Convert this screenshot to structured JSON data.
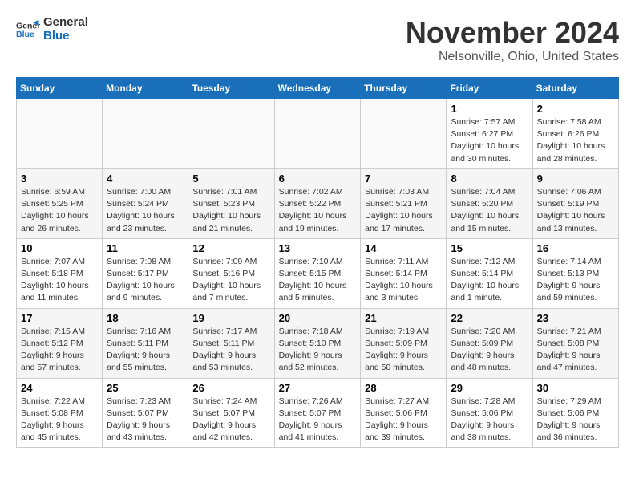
{
  "logo": {
    "line1": "General",
    "line2": "Blue"
  },
  "title": "November 2024",
  "location": "Nelsonville, Ohio, United States",
  "weekdays": [
    "Sunday",
    "Monday",
    "Tuesday",
    "Wednesday",
    "Thursday",
    "Friday",
    "Saturday"
  ],
  "weeks": [
    [
      {
        "day": "",
        "info": ""
      },
      {
        "day": "",
        "info": ""
      },
      {
        "day": "",
        "info": ""
      },
      {
        "day": "",
        "info": ""
      },
      {
        "day": "",
        "info": ""
      },
      {
        "day": "1",
        "info": "Sunrise: 7:57 AM\nSunset: 6:27 PM\nDaylight: 10 hours\nand 30 minutes."
      },
      {
        "day": "2",
        "info": "Sunrise: 7:58 AM\nSunset: 6:26 PM\nDaylight: 10 hours\nand 28 minutes."
      }
    ],
    [
      {
        "day": "3",
        "info": "Sunrise: 6:59 AM\nSunset: 5:25 PM\nDaylight: 10 hours\nand 26 minutes."
      },
      {
        "day": "4",
        "info": "Sunrise: 7:00 AM\nSunset: 5:24 PM\nDaylight: 10 hours\nand 23 minutes."
      },
      {
        "day": "5",
        "info": "Sunrise: 7:01 AM\nSunset: 5:23 PM\nDaylight: 10 hours\nand 21 minutes."
      },
      {
        "day": "6",
        "info": "Sunrise: 7:02 AM\nSunset: 5:22 PM\nDaylight: 10 hours\nand 19 minutes."
      },
      {
        "day": "7",
        "info": "Sunrise: 7:03 AM\nSunset: 5:21 PM\nDaylight: 10 hours\nand 17 minutes."
      },
      {
        "day": "8",
        "info": "Sunrise: 7:04 AM\nSunset: 5:20 PM\nDaylight: 10 hours\nand 15 minutes."
      },
      {
        "day": "9",
        "info": "Sunrise: 7:06 AM\nSunset: 5:19 PM\nDaylight: 10 hours\nand 13 minutes."
      }
    ],
    [
      {
        "day": "10",
        "info": "Sunrise: 7:07 AM\nSunset: 5:18 PM\nDaylight: 10 hours\nand 11 minutes."
      },
      {
        "day": "11",
        "info": "Sunrise: 7:08 AM\nSunset: 5:17 PM\nDaylight: 10 hours\nand 9 minutes."
      },
      {
        "day": "12",
        "info": "Sunrise: 7:09 AM\nSunset: 5:16 PM\nDaylight: 10 hours\nand 7 minutes."
      },
      {
        "day": "13",
        "info": "Sunrise: 7:10 AM\nSunset: 5:15 PM\nDaylight: 10 hours\nand 5 minutes."
      },
      {
        "day": "14",
        "info": "Sunrise: 7:11 AM\nSunset: 5:14 PM\nDaylight: 10 hours\nand 3 minutes."
      },
      {
        "day": "15",
        "info": "Sunrise: 7:12 AM\nSunset: 5:14 PM\nDaylight: 10 hours\nand 1 minute."
      },
      {
        "day": "16",
        "info": "Sunrise: 7:14 AM\nSunset: 5:13 PM\nDaylight: 9 hours\nand 59 minutes."
      }
    ],
    [
      {
        "day": "17",
        "info": "Sunrise: 7:15 AM\nSunset: 5:12 PM\nDaylight: 9 hours\nand 57 minutes."
      },
      {
        "day": "18",
        "info": "Sunrise: 7:16 AM\nSunset: 5:11 PM\nDaylight: 9 hours\nand 55 minutes."
      },
      {
        "day": "19",
        "info": "Sunrise: 7:17 AM\nSunset: 5:11 PM\nDaylight: 9 hours\nand 53 minutes."
      },
      {
        "day": "20",
        "info": "Sunrise: 7:18 AM\nSunset: 5:10 PM\nDaylight: 9 hours\nand 52 minutes."
      },
      {
        "day": "21",
        "info": "Sunrise: 7:19 AM\nSunset: 5:09 PM\nDaylight: 9 hours\nand 50 minutes."
      },
      {
        "day": "22",
        "info": "Sunrise: 7:20 AM\nSunset: 5:09 PM\nDaylight: 9 hours\nand 48 minutes."
      },
      {
        "day": "23",
        "info": "Sunrise: 7:21 AM\nSunset: 5:08 PM\nDaylight: 9 hours\nand 47 minutes."
      }
    ],
    [
      {
        "day": "24",
        "info": "Sunrise: 7:22 AM\nSunset: 5:08 PM\nDaylight: 9 hours\nand 45 minutes."
      },
      {
        "day": "25",
        "info": "Sunrise: 7:23 AM\nSunset: 5:07 PM\nDaylight: 9 hours\nand 43 minutes."
      },
      {
        "day": "26",
        "info": "Sunrise: 7:24 AM\nSunset: 5:07 PM\nDaylight: 9 hours\nand 42 minutes."
      },
      {
        "day": "27",
        "info": "Sunrise: 7:26 AM\nSunset: 5:07 PM\nDaylight: 9 hours\nand 41 minutes."
      },
      {
        "day": "28",
        "info": "Sunrise: 7:27 AM\nSunset: 5:06 PM\nDaylight: 9 hours\nand 39 minutes."
      },
      {
        "day": "29",
        "info": "Sunrise: 7:28 AM\nSunset: 5:06 PM\nDaylight: 9 hours\nand 38 minutes."
      },
      {
        "day": "30",
        "info": "Sunrise: 7:29 AM\nSunset: 5:06 PM\nDaylight: 9 hours\nand 36 minutes."
      }
    ]
  ]
}
